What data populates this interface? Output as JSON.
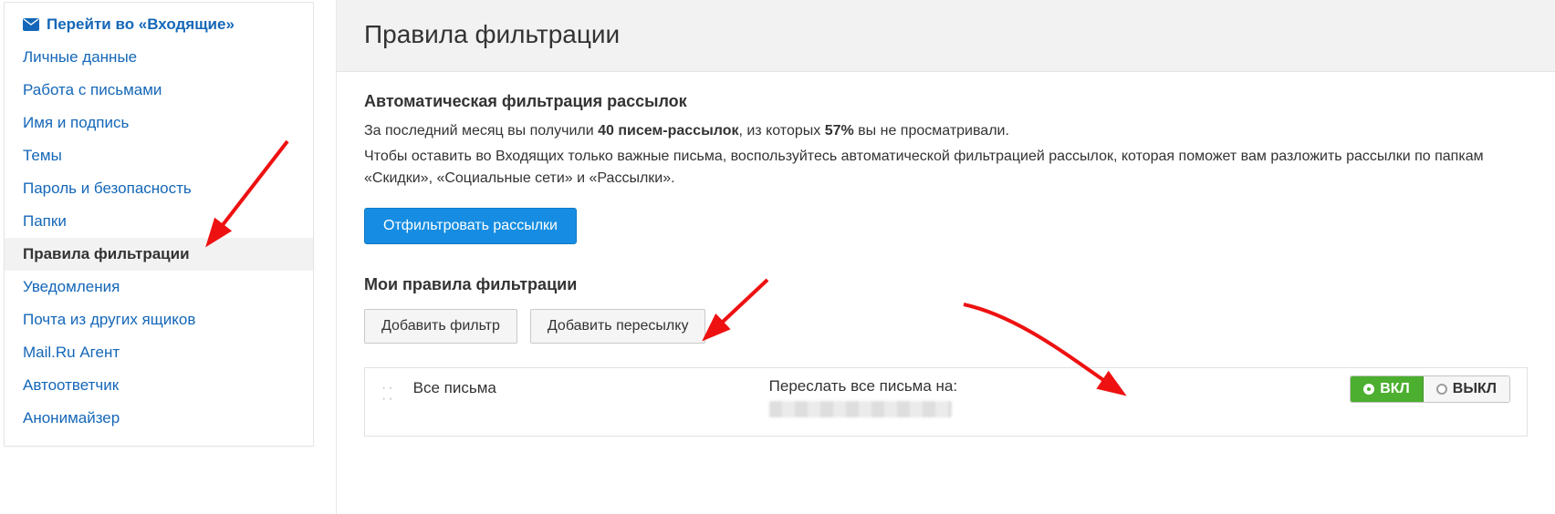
{
  "sidebar": {
    "inbox_link": "Перейти во «Входящие»",
    "items": [
      "Личные данные",
      "Работа с письмами",
      "Имя и подпись",
      "Темы",
      "Пароль и безопасность",
      "Папки",
      "Правила фильтрации",
      "Уведомления",
      "Почта из других ящиков",
      "Mail.Ru Агент",
      "Автоответчик",
      "Анонимайзер"
    ],
    "active_index": 6
  },
  "header": {
    "title": "Правила фильтрации"
  },
  "auto_filter": {
    "title": "Автоматическая фильтрация рассылок",
    "line1_pre": "За последний месяц вы получили ",
    "line1_bold1": "40 писем-рассылок",
    "line1_mid": ", из которых ",
    "line1_bold2": "57%",
    "line1_post": " вы не просматривали.",
    "line2": "Чтобы оставить во Входящих только важные письма, воспользуйтесь автоматической фильтрацией рассылок, которая поможет вам разложить рассылки по папкам «Скидки», «Социальные сети» и «Рассылки».",
    "button": "Отфильтровать рассылки"
  },
  "my_rules": {
    "title": "Мои правила фильтрации",
    "add_filter": "Добавить фильтр",
    "add_forward": "Добавить пересылку"
  },
  "rule": {
    "scope": "Все письма",
    "action": "Переслать все письма на:",
    "toggle_on": "ВКЛ",
    "toggle_off": "ВЫКЛ"
  }
}
